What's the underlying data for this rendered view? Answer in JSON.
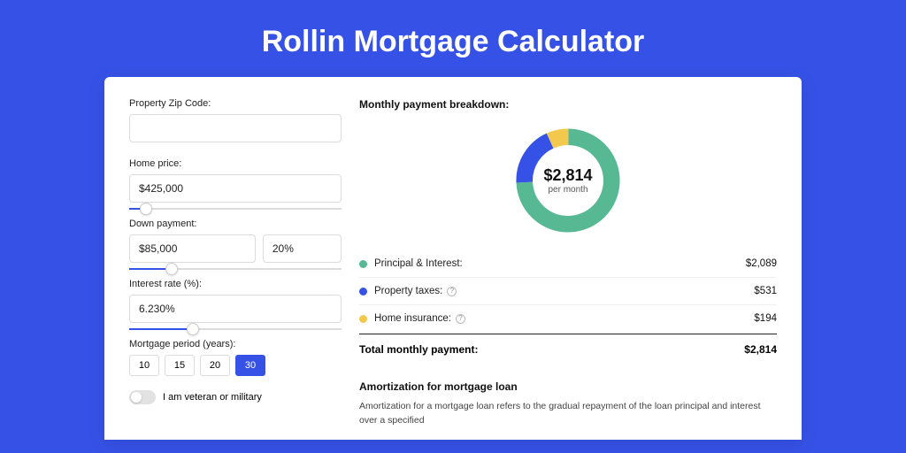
{
  "title": "Rollin Mortgage Calculator",
  "form": {
    "zip": {
      "label": "Property Zip Code:",
      "value": ""
    },
    "price": {
      "label": "Home price:",
      "value": "$425,000",
      "slider_pct": 8
    },
    "down": {
      "label": "Down payment:",
      "amount": "$85,000",
      "percent": "20%",
      "slider_pct": 20
    },
    "rate": {
      "label": "Interest rate (%):",
      "value": "6.230%",
      "slider_pct": 30
    },
    "period": {
      "label": "Mortgage period (years):",
      "options": [
        "10",
        "15",
        "20",
        "30"
      ],
      "active": "30"
    },
    "veteran": {
      "label": "I am veteran or military",
      "checked": false
    }
  },
  "breakdown": {
    "title": "Monthly payment breakdown:",
    "total_amount": "$2,814",
    "total_caption": "per month",
    "items": [
      {
        "label": "Principal & Interest:",
        "value": "$2,089",
        "num": 2089,
        "color": "#57b894",
        "help": false
      },
      {
        "label": "Property taxes:",
        "value": "$531",
        "num": 531,
        "color": "#3652e6",
        "help": true
      },
      {
        "label": "Home insurance:",
        "value": "$194",
        "num": 194,
        "color": "#f2c94c",
        "help": true
      }
    ],
    "total_row": {
      "label": "Total monthly payment:",
      "value": "$2,814"
    }
  },
  "amortization": {
    "title": "Amortization for mortgage loan",
    "body": "Amortization for a mortgage loan refers to the gradual repayment of the loan principal and interest over a specified"
  },
  "chart_data": {
    "type": "pie",
    "title": "Monthly payment breakdown",
    "categories": [
      "Principal & Interest",
      "Property taxes",
      "Home insurance"
    ],
    "values": [
      2089,
      531,
      194
    ],
    "colors": [
      "#57b894",
      "#3652e6",
      "#f2c94c"
    ],
    "total": 2814,
    "center_label": "$2,814 per month"
  }
}
